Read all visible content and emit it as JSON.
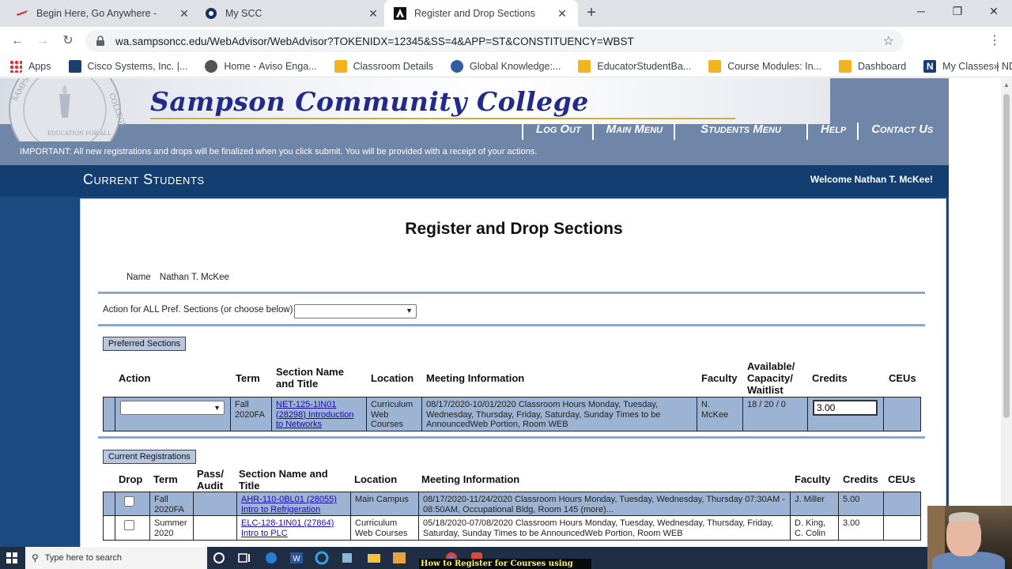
{
  "browser": {
    "tabs": [
      {
        "label": "Begin Here, Go Anywhere -",
        "active": false
      },
      {
        "label": "My SCC",
        "active": false
      },
      {
        "label": "Register and Drop Sections",
        "active": true
      }
    ],
    "url": "wa.sampsoncc.edu/WebAdvisor/WebAdvisor?TOKENIDX=12345&SS=4&APP=ST&CONSTITUENCY=WBST",
    "extension_badge": "4",
    "bookmarks": [
      "Apps",
      "Cisco Systems, Inc. |...",
      "Home - Aviso Enga...",
      "Classroom Details",
      "Global Knowledge:...",
      "EducatorStudentBa...",
      "Course Modules: In...",
      "Dashboard",
      "My Classes | NDG..."
    ]
  },
  "site": {
    "college_name": "Sampson Community College",
    "seal_text_top": "SAMPSON",
    "seal_text_bottom": "EDUCATION FOR ALL",
    "seal_text_right": "COLLEGE",
    "nav": [
      "Log Out",
      "Main Menu",
      "Students Menu",
      "Help",
      "Contact Us"
    ],
    "important": "IMPORTANT: All new registrations and drops will be finalized when you click submit. You will be provided with a receipt of your actions.",
    "section_title": "Current Students",
    "welcome": "Welcome Nathan T. McKee!"
  },
  "form": {
    "title": "Register and Drop Sections",
    "name_label": "Name",
    "name_value": "Nathan T. McKee",
    "action_all_label": "Action for ALL Pref. Sections (or choose below)",
    "preferred": {
      "button": "Preferred Sections",
      "headers": {
        "action": "Action",
        "term": "Term",
        "section": "Section Name and Title",
        "location": "Location",
        "meeting": "Meeting Information",
        "faculty": "Faculty",
        "avail": "Available/ Capacity/ Waitlist",
        "credits": "Credits",
        "ceus": "CEUs"
      },
      "rows": [
        {
          "term": "Fall 2020FA",
          "section": "NET-125-1IN01 (28298) Introduction to Networks",
          "location": "Curriculum Web Courses",
          "meeting": "08/17/2020-10/01/2020 Classroom Hours Monday, Tuesday, Wednesday, Thursday, Friday, Saturday, Sunday Times to be AnnouncedWeb Portion, Room WEB",
          "faculty": "N. McKee",
          "avail": "18 / 20 / 0",
          "credits": "3.00"
        }
      ]
    },
    "current": {
      "button": "Current Registrations",
      "headers": {
        "drop": "Drop",
        "term": "Term",
        "pass": "Pass/ Audit",
        "section": "Section Name and Title",
        "location": "Location",
        "meeting": "Meeting Information",
        "faculty": "Faculty",
        "credits": "Credits",
        "ceus": "CEUs"
      },
      "rows": [
        {
          "term": "Fall 2020FA",
          "section": "AHR-110-0BL01 (28055) Intro to Refrigeration",
          "location": "Main Campus",
          "meeting": "08/17/2020-11/24/2020 Classroom Hours Monday, Tuesday, Wednesday, Thursday 07:30AM - 08:50AM, Occupational Bldg, Room 145 (more)...",
          "faculty": "J. Miller",
          "credits": "5.00"
        },
        {
          "term": "Summer 2020",
          "section": "ELC-128-1IN01 (27864) Intro to PLC",
          "location": "Curriculum Web Courses",
          "meeting": "05/18/2020-07/08/2020 Classroom Hours Monday, Tuesday, Wednesday, Thursday, Friday, Saturday, Sunday Times to be AnnouncedWeb Portion, Room WEB",
          "faculty": "D. King, C. Colin",
          "credits": "3.00"
        }
      ]
    }
  },
  "taskbar": {
    "search_placeholder": "Type here to search",
    "caption": "How to Register for Courses using WebAdvisor"
  },
  "colors": {
    "banner": "#6f86a8",
    "titlebar": "#123e72",
    "row_blue": "#9db3d3",
    "button_blue": "#b7c7df",
    "college_text": "#232b8a"
  }
}
